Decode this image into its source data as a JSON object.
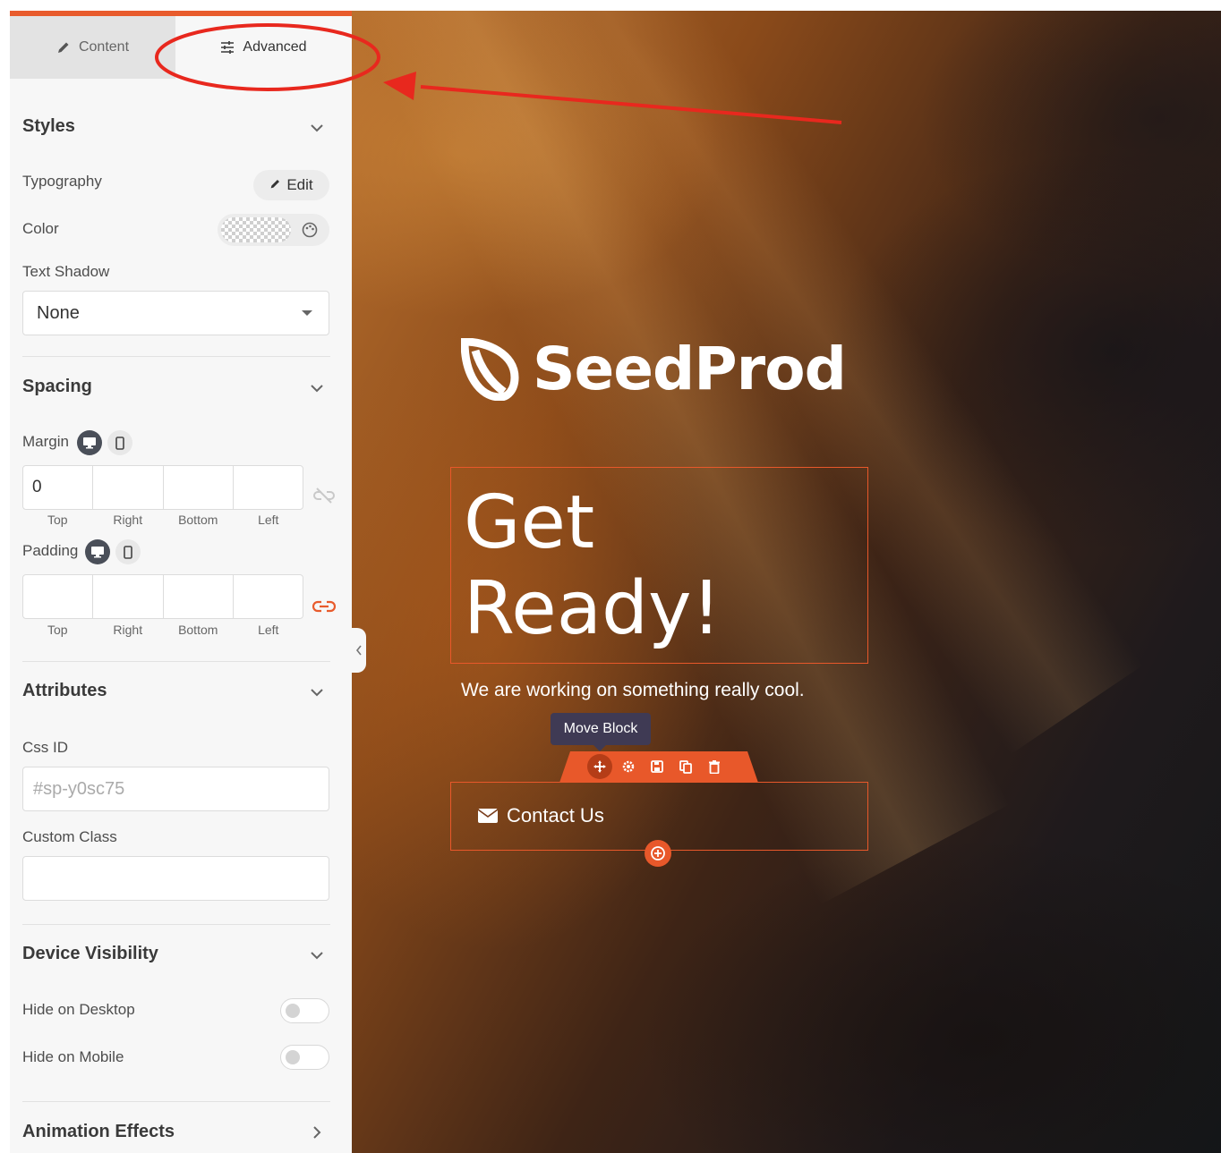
{
  "sidebar": {
    "tabs": [
      {
        "label": "Content",
        "icon": "pencil-icon"
      },
      {
        "label": "Advanced",
        "icon": "sliders-icon"
      }
    ],
    "styles": {
      "title": "Styles",
      "typography_label": "Typography",
      "edit_label": "Edit",
      "color_label": "Color",
      "text_shadow_label": "Text Shadow",
      "text_shadow_value": "None"
    },
    "spacing": {
      "title": "Spacing",
      "margin_label": "Margin",
      "margin_values": {
        "top": "0",
        "right": "",
        "bottom": "",
        "left": ""
      },
      "padding_label": "Padding",
      "padding_values": {
        "top": "",
        "right": "",
        "bottom": "",
        "left": ""
      },
      "side_labels": [
        "Top",
        "Right",
        "Bottom",
        "Left"
      ]
    },
    "attributes": {
      "title": "Attributes",
      "css_id_label": "Css ID",
      "css_id_placeholder": "#sp-y0sc75",
      "custom_class_label": "Custom Class",
      "custom_class_value": ""
    },
    "device_visibility": {
      "title": "Device Visibility",
      "hide_desktop_label": "Hide on Desktop",
      "hide_mobile_label": "Hide on Mobile",
      "hide_desktop": false,
      "hide_mobile": false
    },
    "animation": {
      "title": "Animation Effects"
    }
  },
  "canvas": {
    "logo_text": "SeedProd",
    "headline_line1": "Get",
    "headline_line2": "Ready!",
    "subtext": "We are working on something really cool.",
    "tooltip": "Move Block",
    "contact_button": "Contact Us"
  },
  "colors": {
    "accent": "#e85b2c",
    "annotation": "#e8281e",
    "tooltip_bg": "#3f3a54"
  }
}
